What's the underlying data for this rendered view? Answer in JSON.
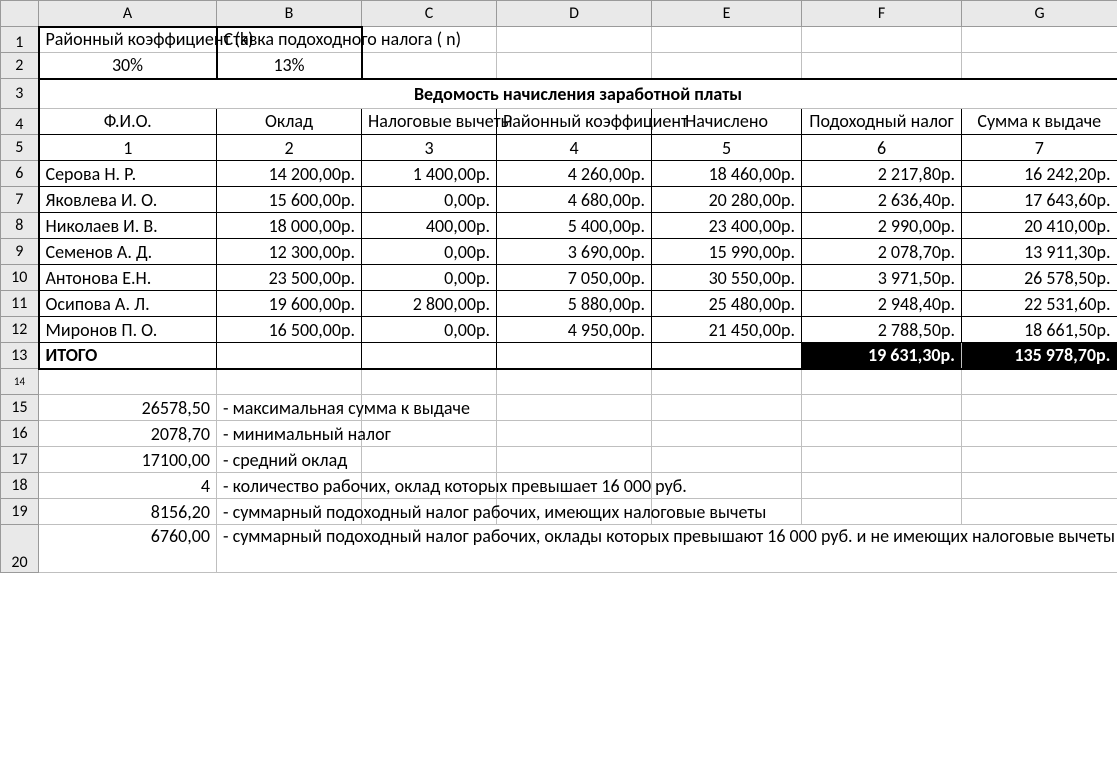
{
  "columns": [
    "A",
    "B",
    "C",
    "D",
    "E",
    "F",
    "G"
  ],
  "rows": [
    "1",
    "2",
    "3",
    "4",
    "5",
    "6",
    "7",
    "8",
    "9",
    "10",
    "11",
    "12",
    "13",
    "14",
    "15",
    "16",
    "17",
    "18",
    "19",
    "20"
  ],
  "params": {
    "k_label": "Районный коэффициент (k)",
    "n_label": "Ставка подоходного налога ( n)",
    "k_value": "30%",
    "n_value": "13%"
  },
  "title": "Ведомость начисления заработной платы",
  "head": {
    "c1": "Ф.И.О.",
    "c2": "Оклад",
    "c3": "Налоговые вычеты",
    "c4": "Районный коэффициент",
    "c5": "Начислено",
    "c6": "Подоходный налог",
    "c7": "Сумма к выдаче"
  },
  "nums": {
    "c1": "1",
    "c2": "2",
    "c3": "3",
    "c4": "4",
    "c5": "5",
    "c6": "6",
    "c7": "7"
  },
  "data": [
    {
      "fio": "Серова Н. Р.",
      "c2": "14 200,00р.",
      "c3": "1 400,00р.",
      "c4": "4 260,00р.",
      "c5": "18 460,00р.",
      "c6": "2 217,80р.",
      "c7": "16 242,20р."
    },
    {
      "fio": "Яковлева И. О.",
      "c2": "15 600,00р.",
      "c3": "0,00р.",
      "c4": "4 680,00р.",
      "c5": "20 280,00р.",
      "c6": "2 636,40р.",
      "c7": "17 643,60р."
    },
    {
      "fio": "Николаев И. В.",
      "c2": "18 000,00р.",
      "c3": "400,00р.",
      "c4": "5 400,00р.",
      "c5": "23 400,00р.",
      "c6": "2 990,00р.",
      "c7": "20 410,00р."
    },
    {
      "fio": "Семенов А. Д.",
      "c2": "12 300,00р.",
      "c3": "0,00р.",
      "c4": "3 690,00р.",
      "c5": "15 990,00р.",
      "c6": "2 078,70р.",
      "c7": "13 911,30р."
    },
    {
      "fio": "Антонова Е.Н.",
      "c2": "23 500,00р.",
      "c3": "0,00р.",
      "c4": "7 050,00р.",
      "c5": "30 550,00р.",
      "c6": "3 971,50р.",
      "c7": "26 578,50р."
    },
    {
      "fio": "Осипова А. Л.",
      "c2": "19 600,00р.",
      "c3": "2 800,00р.",
      "c4": "5 880,00р.",
      "c5": "25 480,00р.",
      "c6": "2 948,40р.",
      "c7": "22 531,60р."
    },
    {
      "fio": "Миронов П. О.",
      "c2": "16 500,00р.",
      "c3": "0,00р.",
      "c4": "4 950,00р.",
      "c5": "21 450,00р.",
      "c6": "2 788,50р.",
      "c7": "18 661,50р."
    }
  ],
  "total": {
    "label": "ИТОГО",
    "c6": "19 631,30р.",
    "c7": "135 978,70р."
  },
  "stats": [
    {
      "v": "26578,50",
      "t": "- максимальная сумма к выдаче"
    },
    {
      "v": "2078,70",
      "t": "- минимальный налог"
    },
    {
      "v": "17100,00",
      "t": "- средний оклад"
    },
    {
      "v": "4",
      "t": "- количество рабочих, оклад которых превышает 16 000 руб."
    },
    {
      "v": "8156,20",
      "t": "- суммарный подоходный налог рабочих, имеющих налоговые вычеты"
    },
    {
      "v": "6760,00",
      "t": "- суммарный подоходный налог рабочих, оклады которых превышают 16 000 руб. и не имеющих налоговые вычеты"
    }
  ]
}
